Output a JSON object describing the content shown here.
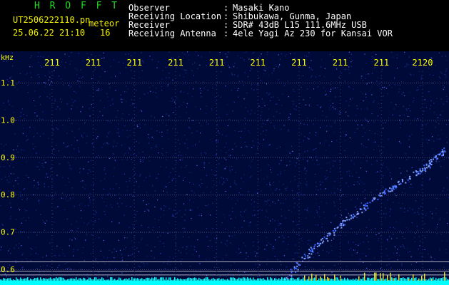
{
  "logo": "H R O F F T",
  "file": {
    "name": "UT2506222110.pn",
    "type": "meteor",
    "datetime": "25.06.22 21:10",
    "count": "16"
  },
  "info": {
    "observer_label": "Observer",
    "observer": "Masaki Kano",
    "location_label": "Receiving Location",
    "location": "Shibukawa, Gunma, Japan",
    "receiver_label": "Receiver",
    "receiver": "SDR# 43dB L15 111.6MHz USB",
    "antenna_label": "Receiving Antenna",
    "antenna": "4ele Yagi Az 230 for Kansai VOR"
  },
  "colors": {
    "header_green": "#22dd22",
    "header_yellow": "#f0f000",
    "waterfall_bg": "#000a38",
    "noise": "#3040c0",
    "trail": "#80a0ff",
    "baseline": "#00ffff"
  },
  "chart_data": {
    "type": "heatmap",
    "y_unit": "kHz",
    "y_ticks": [
      "1.1",
      "1.0",
      "0.9",
      "0.8",
      "0.7",
      "0.6"
    ],
    "time_ticks": [
      "211",
      "211",
      "211",
      "211",
      "211",
      "211",
      "211",
      "211",
      "211",
      "2120"
    ],
    "reference_lines_khz": [
      0.62,
      0.595,
      0.585
    ],
    "trail": [
      {
        "t": 0.63,
        "f": 0.57
      },
      {
        "t": 0.7,
        "f": 0.66
      },
      {
        "t": 0.78,
        "f": 0.74
      },
      {
        "t": 0.86,
        "f": 0.81
      },
      {
        "t": 0.94,
        "f": 0.87
      },
      {
        "t": 0.99,
        "f": 0.92
      }
    ]
  }
}
